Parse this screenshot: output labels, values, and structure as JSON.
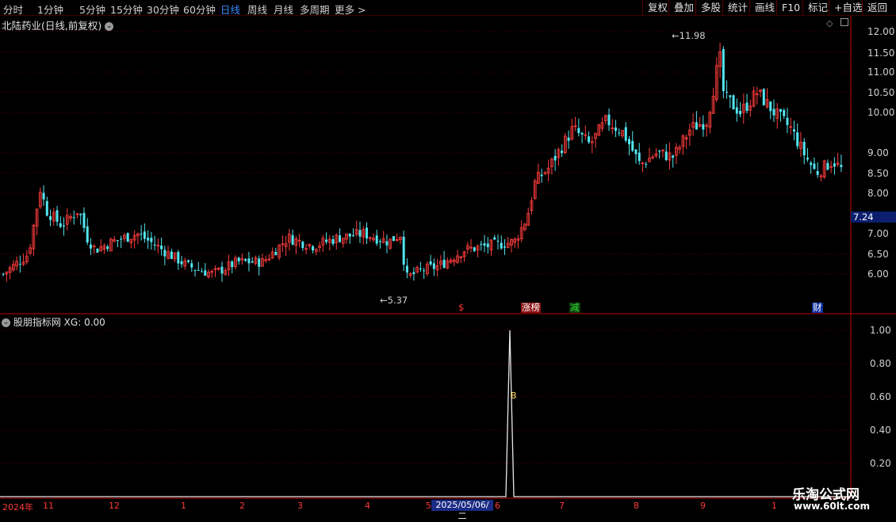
{
  "toolbar": {
    "left_items": [
      "分时",
      "1分钟",
      "5分钟",
      "15分钟",
      "30分钟",
      "60分钟",
      "日线",
      "周线",
      "月线",
      "多周期",
      "更多 >"
    ],
    "active_item": "日线",
    "right_items": [
      "复权",
      "叠加",
      "多股",
      "统计",
      "画线",
      "F10",
      "标记",
      "+自选",
      "返回"
    ]
  },
  "main_chart": {
    "title": "北陆药业(日线,前复权)",
    "high_label": "11.98",
    "low_label": "5.37",
    "current_price": "7.24",
    "y_axis": [
      "12.00",
      "11.50",
      "11.00",
      "10.50",
      "10.00",
      "9.00",
      "8.50",
      "8.00",
      "7.00",
      "6.50",
      "6.00"
    ],
    "events": [
      {
        "label": "$",
        "color": "#ff3333",
        "bg": "#000000"
      },
      {
        "label": "涨榜",
        "color": "#ffffff",
        "bg": "#8a1010"
      },
      {
        "label": "减",
        "color": "#33dd33",
        "bg": "#0e3a0e"
      },
      {
        "label": "财",
        "color": "#ffffff",
        "bg": "#1030a0"
      }
    ],
    "colors": {
      "up": "#ff3d3d",
      "down": "#52e6f0",
      "grid": "#5a0000",
      "axis": "#c00000"
    }
  },
  "chart_data": {
    "type": "candlestick",
    "title": "北陆药业(日线,前复权)",
    "y_range": [
      5.1,
      12.2
    ],
    "annotated_high": 11.98,
    "annotated_low": 5.37,
    "last_close": 7.24,
    "close_path": [
      [
        0,
        6.0
      ],
      [
        0.03,
        6.5
      ],
      [
        0.045,
        8.2
      ],
      [
        0.05,
        7.6
      ],
      [
        0.07,
        7.2
      ],
      [
        0.09,
        7.6
      ],
      [
        0.1,
        6.9
      ],
      [
        0.11,
        6.6
      ],
      [
        0.13,
        6.8
      ],
      [
        0.16,
        7.0
      ],
      [
        0.19,
        6.6
      ],
      [
        0.22,
        6.2
      ],
      [
        0.25,
        6.0
      ],
      [
        0.28,
        6.3
      ],
      [
        0.31,
        6.3
      ],
      [
        0.34,
        6.9
      ],
      [
        0.37,
        6.7
      ],
      [
        0.4,
        6.9
      ],
      [
        0.43,
        7.0
      ],
      [
        0.46,
        6.8
      ],
      [
        0.475,
        7.0
      ],
      [
        0.48,
        5.9
      ],
      [
        0.5,
        6.1
      ],
      [
        0.52,
        6.2
      ],
      [
        0.55,
        6.6
      ],
      [
        0.58,
        6.7
      ],
      [
        0.61,
        6.8
      ],
      [
        0.625,
        7.4
      ],
      [
        0.635,
        8.3
      ],
      [
        0.65,
        8.6
      ],
      [
        0.68,
        9.6
      ],
      [
        0.7,
        9.2
      ],
      [
        0.72,
        9.8
      ],
      [
        0.74,
        9.5
      ],
      [
        0.76,
        8.7
      ],
      [
        0.78,
        9.0
      ],
      [
        0.8,
        8.9
      ],
      [
        0.82,
        9.6
      ],
      [
        0.84,
        9.8
      ],
      [
        0.855,
        11.4
      ],
      [
        0.86,
        10.4
      ],
      [
        0.88,
        10.0
      ],
      [
        0.9,
        10.5
      ],
      [
        0.92,
        10.0
      ],
      [
        0.94,
        9.6
      ],
      [
        0.955,
        9.0
      ],
      [
        0.97,
        8.5
      ],
      [
        0.99,
        8.8
      ],
      [
        1.0,
        8.6
      ]
    ],
    "indicator": {
      "name": "股朋指标网",
      "series": "XG",
      "value": "0.00",
      "y_axis": [
        "1.00",
        "0.80",
        "0.60",
        "0.40",
        "0.20"
      ],
      "y_range": [
        0.0,
        1.05
      ],
      "signal_value": 1.0,
      "signal_marker": "B"
    },
    "x_axis": [
      "2024年",
      "11",
      "12",
      "1",
      "2",
      "3",
      "4",
      "5",
      "6",
      "7",
      "8",
      "9",
      "1"
    ],
    "selected_date": "2025/05/06/二"
  },
  "watermark": {
    "title": "乐淘公式网",
    "url": "www.60lt.com"
  }
}
